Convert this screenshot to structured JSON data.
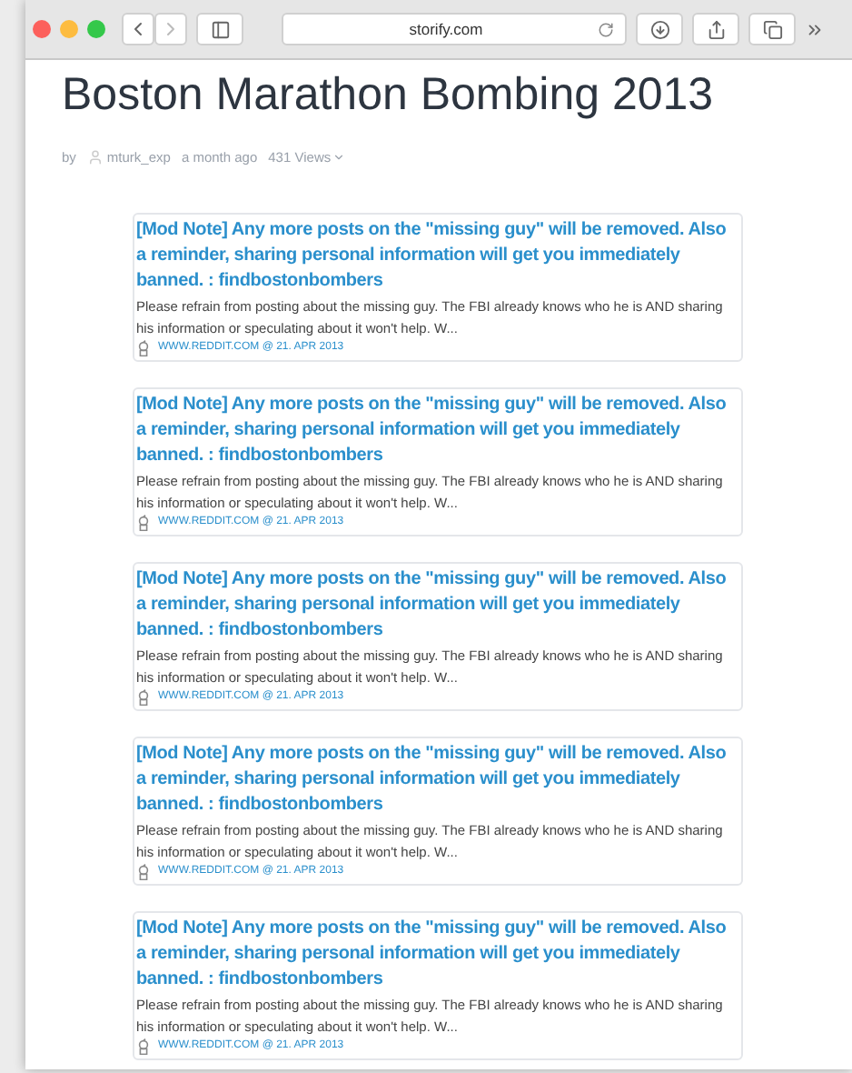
{
  "browser": {
    "address": "storify.com"
  },
  "story": {
    "title": "Boston Marathon Bombing 2013",
    "by": "by",
    "author": "mturk_exp",
    "age": "a month ago",
    "views": "431 Views"
  },
  "posts": [
    {
      "title": "[Mod Note] Any more posts on the \"missing guy\" will be removed. Also a reminder, sharing personal information will get you immediately banned. : findbostonbombers",
      "excerpt": "Please refrain from posting about the missing guy. The FBI already knows who he is AND sharing his information or speculating about it won't help. W...",
      "source": "WWW.REDDIT.COM @ 21. APR 2013"
    },
    {
      "title": "[Mod Note] Any more posts on the \"missing guy\" will be removed. Also a reminder, sharing personal information will get you immediately banned. : findbostonbombers",
      "excerpt": "Please refrain from posting about the missing guy. The FBI already knows who he is AND sharing his information or speculating about it won't help. W...",
      "source": "WWW.REDDIT.COM @ 21. APR 2013"
    },
    {
      "title": "[Mod Note] Any more posts on the \"missing guy\" will be removed. Also a reminder, sharing personal information will get you immediately banned. : findbostonbombers",
      "excerpt": "Please refrain from posting about the missing guy. The FBI already knows who he is AND sharing his information or speculating about it won't help. W...",
      "source": "WWW.REDDIT.COM @ 21. APR 2013"
    },
    {
      "title": "[Mod Note] Any more posts on the \"missing guy\" will be removed. Also a reminder, sharing personal information will get you immediately banned. : findbostonbombers",
      "excerpt": "Please refrain from posting about the missing guy. The FBI already knows who he is AND sharing his information or speculating about it won't help. W...",
      "source": "WWW.REDDIT.COM @ 21. APR 2013"
    },
    {
      "title": "[Mod Note] Any more posts on the \"missing guy\" will be removed. Also a reminder, sharing personal information will get you immediately banned. : findbostonbombers",
      "excerpt": "Please refrain from posting about the missing guy. The FBI already knows who he is AND sharing his information or speculating about it won't help. W...",
      "source": "WWW.REDDIT.COM @ 21. APR 2013"
    }
  ]
}
